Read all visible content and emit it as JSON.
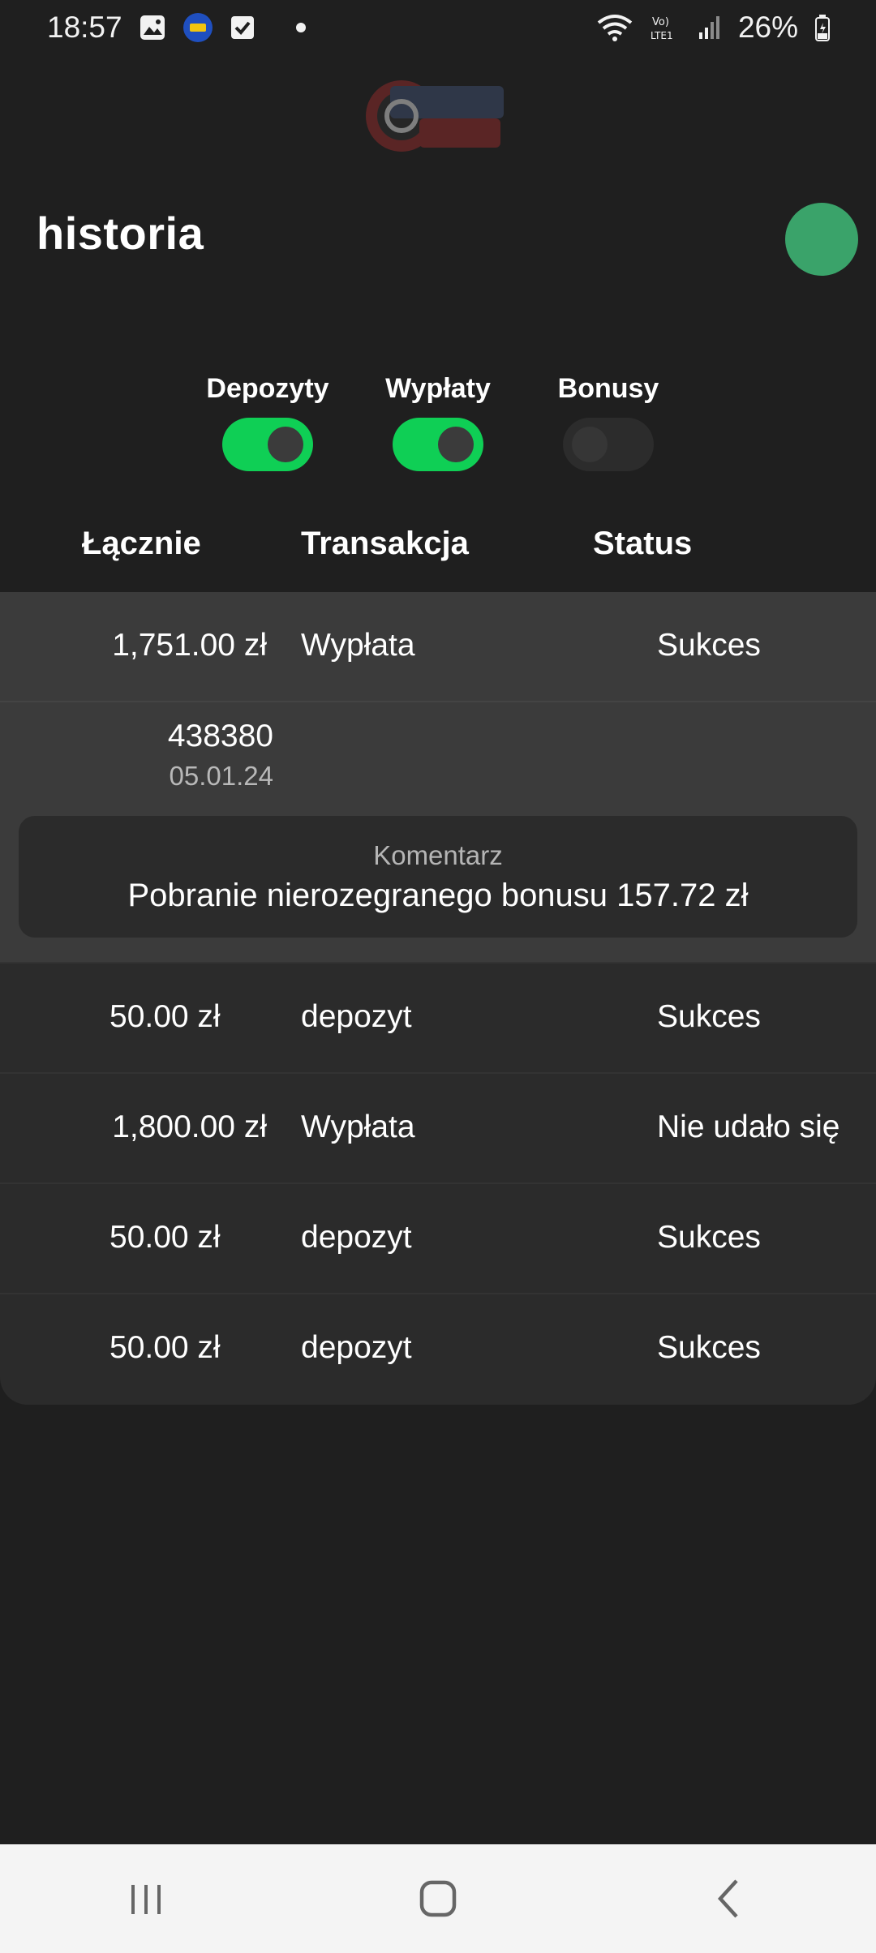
{
  "status_bar": {
    "time": "18:57",
    "battery": "26%",
    "icons": [
      "gallery-icon",
      "app-icon",
      "checkbox-icon",
      "wifi-icon",
      "volte-icon",
      "signal-icon",
      "battery-icon"
    ]
  },
  "header": {
    "title": "historia"
  },
  "filters": [
    {
      "label": "Depozyty",
      "on": true
    },
    {
      "label": "Wypłaty",
      "on": true
    },
    {
      "label": "Bonusy",
      "on": false
    }
  ],
  "table": {
    "headers": {
      "total": "Łącznie",
      "transaction": "Transakcja",
      "status": "Status"
    },
    "expanded": {
      "amount": "1,751.00 zł",
      "type": "Wypłata",
      "status": "Sukces",
      "id": "438380",
      "date": "05.01.24",
      "comment_label": "Komentarz",
      "comment": "Pobranie nierozegranego bonusu 157.72 zł"
    },
    "rows": [
      {
        "amount": "50.00 zł",
        "type": "depozyt",
        "status": "Sukces"
      },
      {
        "amount": "1,800.00 zł",
        "type": "Wypłata",
        "status": "Nie udało się"
      },
      {
        "amount": "50.00 zł",
        "type": "depozyt",
        "status": "Sukces"
      },
      {
        "amount": "50.00 zł",
        "type": "depozyt",
        "status": "Sukces"
      }
    ]
  },
  "colors": {
    "background": "#1f1f1f",
    "toggle_on": "#0fcf55",
    "avatar": "#3aa36a",
    "row_bg": "#2b2b2b",
    "row_active": "#3b3b3b"
  }
}
